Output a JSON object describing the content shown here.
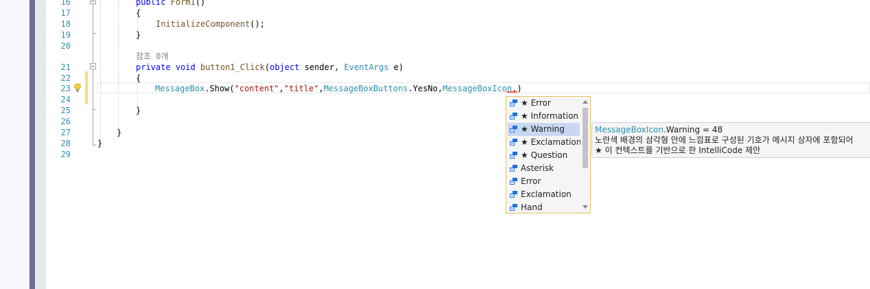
{
  "editor": {
    "line_numbers": [
      "16",
      "17",
      "18",
      "19",
      "20",
      "21",
      "22",
      "23",
      "24",
      "25",
      "26",
      "27",
      "28",
      "29"
    ],
    "reference_codelens": "참조 0개",
    "lines": {
      "l16": {
        "kw": "public",
        "method": "Form1",
        "rest": "()"
      },
      "l17": {
        "text": "{"
      },
      "l18": {
        "method": "InitializeComponent",
        "rest": "();"
      },
      "l19": {
        "text": "}"
      },
      "l21": {
        "kw1": "private",
        "kw2": "void",
        "method": "button1_Click",
        "p1": "(",
        "kw3": "object",
        "p2": " sender, ",
        "type": "EventArgs",
        "p3": " e)"
      },
      "l22": {
        "text": "{"
      },
      "l23": {
        "type1": "MessageBox",
        "p1": ".",
        "method": "Show",
        "p2": "(",
        "str1": "\"content\"",
        "p3": ",",
        "str2": "\"title\"",
        "p4": ",",
        "type2": "MessageBoxButtons",
        "p5": ".YesNo,",
        "type3": "MessageBoxIcon",
        "p6": ".)"
      },
      "l25": {
        "text": "}"
      },
      "l27": {
        "text": "}"
      },
      "l28": {
        "text": "}"
      }
    }
  },
  "completion": {
    "items": [
      {
        "label": "★ Error",
        "icon": "enum-member-icon"
      },
      {
        "label": "★ Information",
        "icon": "enum-member-icon"
      },
      {
        "label": "★ Warning",
        "icon": "enum-member-icon",
        "selected": true
      },
      {
        "label": "★ Exclamation",
        "icon": "enum-member-icon"
      },
      {
        "label": "★ Question",
        "icon": "enum-member-icon"
      },
      {
        "label": "Asterisk",
        "icon": "enum-member-icon"
      },
      {
        "label": "Error",
        "icon": "enum-member-icon"
      },
      {
        "label": "Exclamation",
        "icon": "enum-member-icon"
      },
      {
        "label": "Hand",
        "icon": "enum-member-icon"
      }
    ]
  },
  "tooltip": {
    "type_name": "MessageBoxIcon",
    "member_rest": ".Warning = 48",
    "description": "노란색 배경의 삼각형 안에 느낌표로 구성된 기호가 메시지 상자에 포함되어",
    "intellicode_note": "★  이 컨텍스트를 기반으로 한 IntelliCode 제안"
  },
  "colors": {
    "keyword": "#0000ff",
    "type": "#2b91af",
    "method": "#74531f",
    "string": "#a31515",
    "line_number": "#2b91af",
    "accent_bar": "#6b6e9d",
    "selection": "#c9d8f2",
    "popup_border": "#e5c365"
  }
}
